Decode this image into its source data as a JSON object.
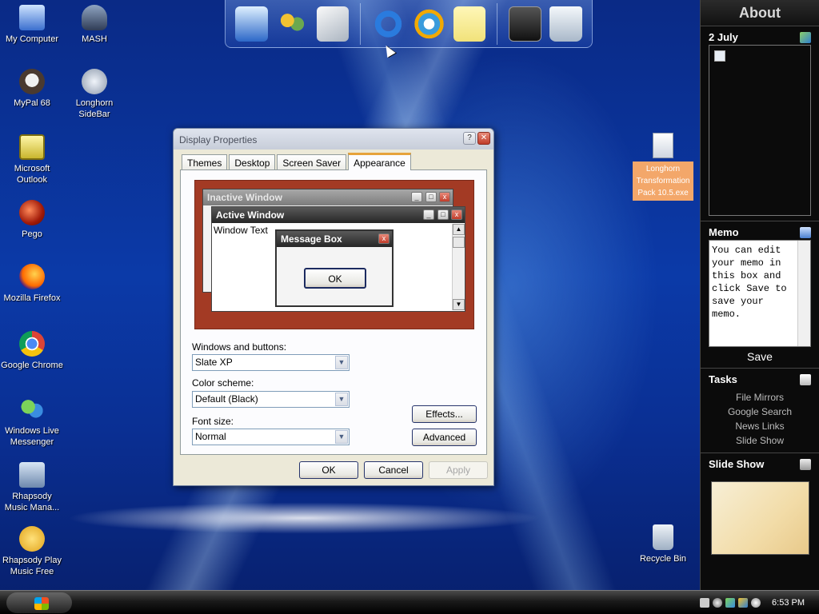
{
  "desktop": {
    "icons": [
      {
        "label": "My Computer"
      },
      {
        "label": "MASH"
      },
      {
        "label": "MyPal 68"
      },
      {
        "label": "Longhorn SideBar"
      },
      {
        "label": "Microsoft Outlook"
      },
      {
        "label": "Pego"
      },
      {
        "label": "Mozilla Firefox"
      },
      {
        "label": "Google Chrome"
      },
      {
        "label": "Windows Live Messenger"
      },
      {
        "label": "Rhapsody Music Mana..."
      },
      {
        "label": "Rhapsody Play Music Free"
      },
      {
        "label": "Recycle Bin"
      }
    ],
    "file_icon_label": "Longhorn Transformation Pack 10.5.exe"
  },
  "dock": {
    "items": [
      "computer-icon",
      "users-icon",
      "scanner-icon",
      "internet-explorer-icon",
      "media-player-icon",
      "notes-icon",
      "settings-icon",
      "recycle-bin-icon"
    ]
  },
  "dialog": {
    "title": "Display Properties",
    "help_label": "?",
    "close_label": "✕",
    "tabs": [
      "Themes",
      "Desktop",
      "Screen Saver",
      "Appearance"
    ],
    "active_tab": "Appearance",
    "preview": {
      "inactive_title": "Inactive Window",
      "active_title": "Active Window",
      "window_text": "Window Text",
      "message_title": "Message Box",
      "message_ok": "OK"
    },
    "windows_buttons_label": "Windows and buttons:",
    "windows_buttons_value": "Slate XP",
    "color_scheme_label": "Color scheme:",
    "color_scheme_value": "Default (Black)",
    "font_size_label": "Font size:",
    "font_size_value": "Normal",
    "effects_label": "Effects...",
    "advanced_label": "Advanced",
    "ok_label": "OK",
    "cancel_label": "Cancel",
    "apply_label": "Apply"
  },
  "sidebar": {
    "header": "About",
    "date": "2 July",
    "memo_title": "Memo",
    "memo_text": "You can edit your memo in this box and click Save to save your memo.",
    "memo_save": "Save",
    "tasks_title": "Tasks",
    "tasks": [
      "File Mirrors",
      "Google Search",
      "News Links",
      "Slide Show"
    ],
    "slideshow_title": "Slide Show"
  },
  "taskbar": {
    "clock": "6:53 PM"
  },
  "colors": {
    "accent": "#e6a33a",
    "preview_bg": "#a33a24",
    "sidebar_bg": "#0b0b0b"
  }
}
